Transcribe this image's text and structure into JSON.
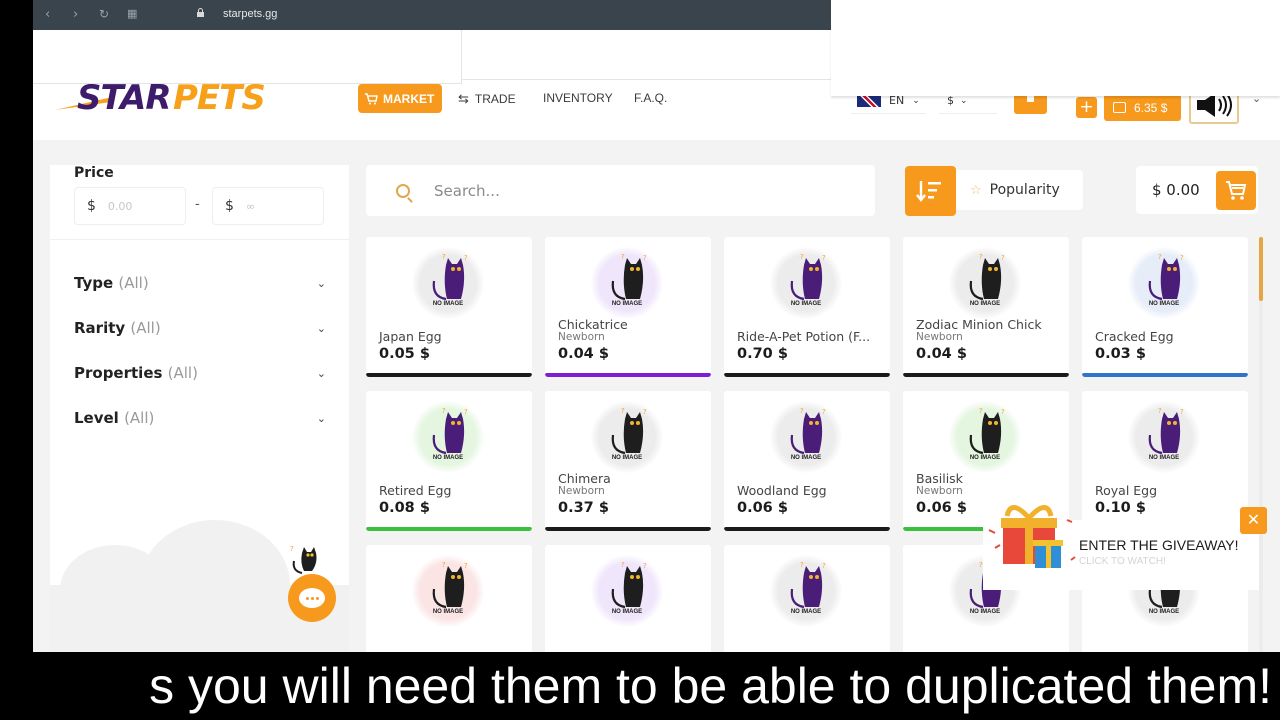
{
  "browser": {
    "url": "starpets.gg",
    "back_icon": "chevron-left-icon",
    "forward_icon": "chevron-right-icon",
    "reload_icon": "reload-icon",
    "tabs_icon": "grid-icon",
    "lock_icon": "lock-icon"
  },
  "header": {
    "logo_part1": "STAR",
    "logo_part2": "PETS",
    "nav": [
      {
        "label": "MARKET",
        "icon": "cart-icon",
        "active": true
      },
      {
        "label": "TRADE",
        "icon": "swap-icon"
      },
      {
        "label": "INVENTORY"
      },
      {
        "label": "F.A.Q."
      }
    ],
    "language": "EN",
    "currency": "$",
    "balance": "6.35 $",
    "add_funds_label": "+",
    "avatar_icon": "speaker-icon"
  },
  "sidebar": {
    "price_label": "Price",
    "price_min_symbol": "$",
    "price_min_placeholder": "0.00",
    "price_max_symbol": "$",
    "price_max_placeholder": "∞",
    "price_dash": "-",
    "filters": [
      {
        "label": "Type",
        "value": "(All)"
      },
      {
        "label": "Rarity",
        "value": "(All)"
      },
      {
        "label": "Properties",
        "value": "(All)"
      },
      {
        "label": "Level",
        "value": "(All)"
      }
    ]
  },
  "toolbar": {
    "search_placeholder": "Search...",
    "sort_label": "Popularity",
    "cart_total": "$ 0.00"
  },
  "cards": [
    {
      "name": "Japan Egg",
      "sub": "",
      "price": "0.05 $",
      "rarity_color": "#1b1b1b",
      "cat": "purple",
      "glow": "#ececec"
    },
    {
      "name": "Chickatrice",
      "sub": "Newborn",
      "price": "0.04 $",
      "rarity_color": "#7a1fd6",
      "cat": "black",
      "glow": "#efe6fb"
    },
    {
      "name": "Ride-A-Pet Potion (F...",
      "sub": "",
      "price": "0.70 $",
      "rarity_color": "#1b1b1b",
      "cat": "purple",
      "glow": "#ececec"
    },
    {
      "name": "Zodiac Minion Chick",
      "sub": "Newborn",
      "price": "0.04 $",
      "rarity_color": "#1b1b1b",
      "cat": "black",
      "glow": "#ececec"
    },
    {
      "name": "Cracked Egg",
      "sub": "",
      "price": "0.03 $",
      "rarity_color": "#2f73cc",
      "cat": "purple",
      "glow": "#e6edf8"
    },
    {
      "name": "Retired Egg",
      "sub": "",
      "price": "0.08 $",
      "rarity_color": "#3cbf3c",
      "cat": "purple",
      "glow": "#e4f6e0"
    },
    {
      "name": "Chimera",
      "sub": "Newborn",
      "price": "0.37 $",
      "rarity_color": "#1b1b1b",
      "cat": "black",
      "glow": "#ececec"
    },
    {
      "name": "Woodland Egg",
      "sub": "",
      "price": "0.06 $",
      "rarity_color": "#1b1b1b",
      "cat": "purple",
      "glow": "#ececec"
    },
    {
      "name": "Basilisk",
      "sub": "Newborn",
      "price": "0.06 $",
      "rarity_color": "#3cbf3c",
      "cat": "black",
      "glow": "#e4f6e0"
    },
    {
      "name": "Royal Egg",
      "sub": "",
      "price": "0.10 $",
      "rarity_color": "#1b1b1b",
      "cat": "purple",
      "glow": "#ececec"
    },
    {
      "name": "",
      "sub": "",
      "price": "",
      "rarity_color": "",
      "cat": "black",
      "glow": "#fbe4e4"
    },
    {
      "name": "",
      "sub": "",
      "price": "",
      "rarity_color": "",
      "cat": "black",
      "glow": "#efe6fb"
    },
    {
      "name": "",
      "sub": "",
      "price": "",
      "rarity_color": "",
      "cat": "purple",
      "glow": "#ececec"
    },
    {
      "name": "",
      "sub": "",
      "price": "",
      "rarity_color": "",
      "cat": "purple",
      "glow": "#ececec"
    },
    {
      "name": "",
      "sub": "",
      "price": "",
      "rarity_color": "",
      "cat": "black",
      "glow": "#ececec"
    }
  ],
  "no_image_label": "NO IMAGE",
  "giveaway": {
    "title": "ENTER THE GIVEAWAY!",
    "subtitle": "CLICK TO WATCH!",
    "close_label": "✕"
  },
  "caption": "s you will need them to be able to duplicated them!",
  "colors": {
    "accent": "#f7991c",
    "brand_purple": "#3d1d6b"
  }
}
